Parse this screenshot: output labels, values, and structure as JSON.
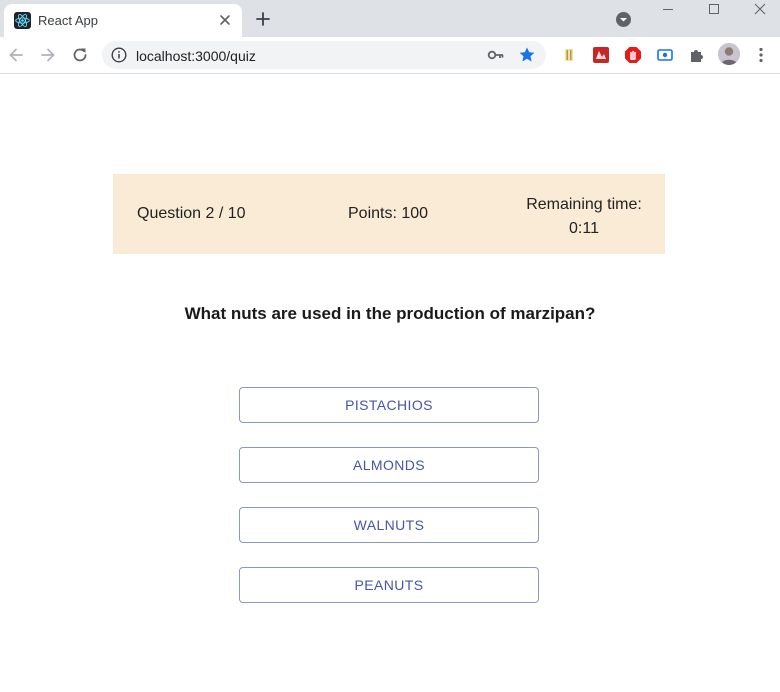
{
  "browser": {
    "tab": {
      "title": "React App",
      "favicon": "react-logo-icon"
    },
    "address_bar": {
      "url": "localhost:3000/quiz"
    },
    "accent_color": "#1a73e8"
  },
  "quiz": {
    "score_bar": {
      "question_progress": "Question 2 / 10",
      "points": "Points: 100",
      "remaining_time_label": "Remaining time:",
      "remaining_time_value": "0:11",
      "background_color": "#faebd7"
    },
    "question": "What nuts are used in the production of marzipan?",
    "answers": [
      {
        "label": "PISTACHIOS"
      },
      {
        "label": "ALMONDS"
      },
      {
        "label": "WALNUTS"
      },
      {
        "label": "PEANUTS"
      }
    ],
    "answer_color": "#4854a6"
  }
}
